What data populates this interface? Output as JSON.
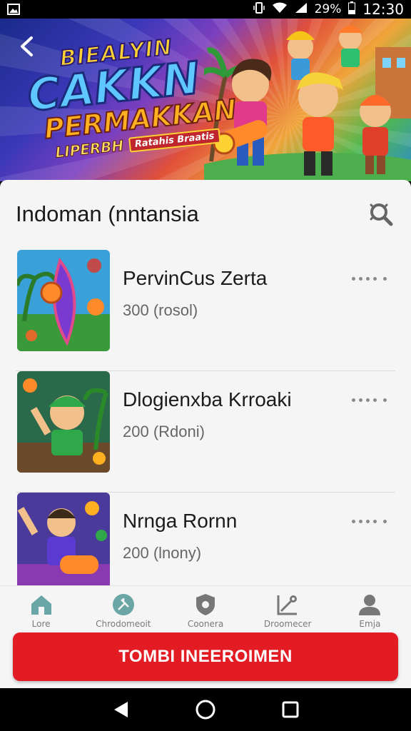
{
  "status_bar": {
    "battery": "29%",
    "time": "12:30",
    "icons": [
      "gallery-icon",
      "vibrate-icon",
      "wifi-icon",
      "signal-icon",
      "battery-icon"
    ]
  },
  "banner": {
    "line1": "BIEALYIN",
    "line2": "CAKKN",
    "line3": "PERMAKKAN",
    "line4a": "LIPERBH",
    "line4b": "Ratahis Braatis",
    "back_icon": "chevron-left-icon"
  },
  "section": {
    "title": "Indoman (nntansia",
    "search_icon": "search-icon"
  },
  "items": [
    {
      "title": "PervinCus Zerta",
      "subtitle": "300 (rosol)"
    },
    {
      "title": "Dlogienxba Krroaki",
      "subtitle": "200 (Rdoni)"
    },
    {
      "title": "Nrnga Rornn",
      "subtitle": "200 (lnony)"
    }
  ],
  "nav": [
    {
      "label": "Lore",
      "icon": "home-icon"
    },
    {
      "label": "Chrodomeoit",
      "icon": "compass-icon"
    },
    {
      "label": "Coonera",
      "icon": "shield-icon"
    },
    {
      "label": "Droomecer",
      "icon": "chart-icon"
    },
    {
      "label": "Emja",
      "icon": "profile-icon"
    }
  ],
  "cta": {
    "label": "TOMBI INEEROIMEN"
  },
  "colors": {
    "accent": "#e31b23",
    "nav_active": "#6aa6a6"
  }
}
